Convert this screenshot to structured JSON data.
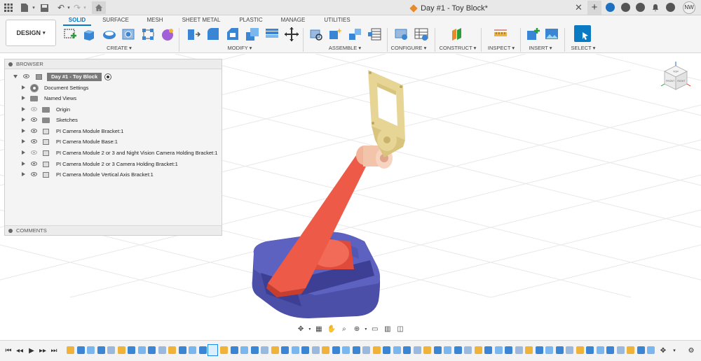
{
  "window": {
    "doc_title": "Day #1 - Toy Block*",
    "user_initials": "NW"
  },
  "ribbon": {
    "workspace": "DESIGN",
    "tabs": [
      {
        "label": "SOLID",
        "active": true
      },
      {
        "label": "SURFACE"
      },
      {
        "label": "MESH"
      },
      {
        "label": "SHEET METAL"
      },
      {
        "label": "PLASTIC"
      },
      {
        "label": "MANAGE"
      },
      {
        "label": "UTILITIES"
      }
    ],
    "groups": [
      "CREATE ▾",
      "MODIFY ▾",
      "ASSEMBLE ▾",
      "CONFIGURE ▾",
      "CONSTRUCT ▾",
      "INSPECT ▾",
      "INSERT ▾",
      "SELECT ▾"
    ]
  },
  "browser": {
    "header": "BROWSER",
    "root": "Day #1 - Toy Block",
    "items": [
      {
        "label": "Document Settings",
        "icon": "gear-icon"
      },
      {
        "label": "Named Views",
        "icon": "folder-icon"
      },
      {
        "label": "Origin",
        "icon": "folder-icon"
      },
      {
        "label": "Sketches",
        "icon": "folder-icon"
      },
      {
        "label": "PI Camera Module Bracket:1",
        "icon": "component-icon"
      },
      {
        "label": "PI Camera Module Base:1",
        "icon": "component-icon"
      },
      {
        "label": "PI Camera Module 2 or 3 and Night Vision Camera Holding Bracket:1",
        "icon": "component-icon"
      },
      {
        "label": "PI Camera Module 2 or 3 Camera Holding Bracket:1",
        "icon": "component-icon"
      },
      {
        "label": "PI Camera Module Vertical Axis Bracket:1",
        "icon": "component-icon"
      }
    ],
    "comments": "COMMENTS"
  },
  "viewcube": {
    "top": "TOP",
    "front": "FRONT",
    "right": "RIGHT"
  },
  "colors": {
    "accent": "#0a7ac2",
    "base_blue": "#4b4fa8",
    "arm_red": "#ee5a48",
    "bracket_tan": "#e7d596",
    "hinge_peach": "#f2b59a"
  }
}
